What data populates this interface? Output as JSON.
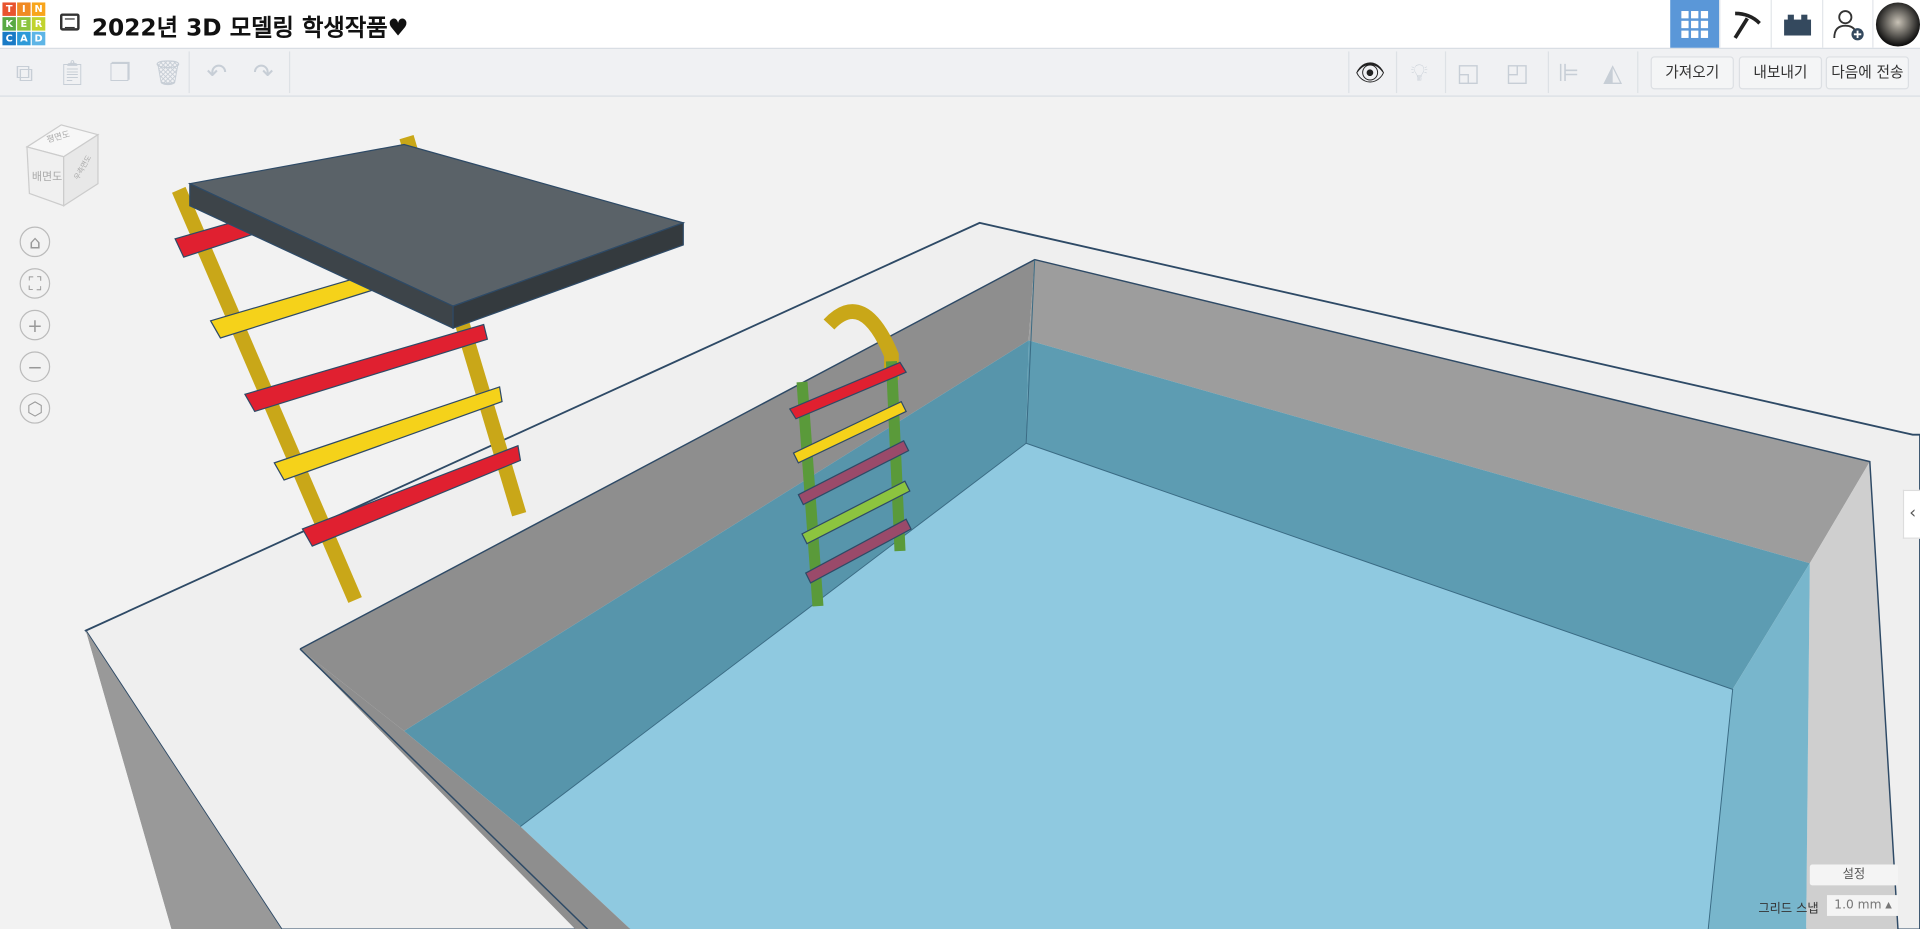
{
  "app": {
    "logo_letters": [
      "T",
      "I",
      "N",
      "K",
      "E",
      "R",
      "C",
      "A",
      "D"
    ],
    "logo_colors": [
      "#e8542f",
      "#f08a24",
      "#f8a51c",
      "#59a944",
      "#8cc43f",
      "#c1d32f",
      "#1a7bc6",
      "#2d9ad8",
      "#5eb5e6"
    ],
    "title": "2022년 3D 모델링 학생작품♥"
  },
  "header_icons": [
    {
      "name": "grid-view-icon",
      "active": true
    },
    {
      "name": "pickaxe-icon"
    },
    {
      "name": "brick-icon"
    },
    {
      "name": "add-user-icon"
    },
    {
      "name": "avatar"
    }
  ],
  "toolbar": {
    "left_tools": [
      "copy-icon",
      "paste-icon",
      "duplicate-icon",
      "delete-icon",
      "undo-icon",
      "redo-icon"
    ],
    "right_tools": [
      "notes-icon",
      "light-icon",
      "shape-group-icon",
      "shape-ungroup-icon",
      "align-icon",
      "mirror-icon"
    ],
    "import_label": "가져오기",
    "export_label": "내보내기",
    "send_label": "다음에 전송"
  },
  "viewcube": {
    "top": "평면도",
    "front": "배면도",
    "side": "우측면도"
  },
  "view_controls": [
    "home-icon",
    "fit-icon",
    "zoom-in-icon",
    "zoom-out-icon",
    "perspective-icon"
  ],
  "footer": {
    "settings_label": "설정",
    "grid_snap_label": "그리드 스냅",
    "grid_snap_value": "1.0 mm"
  },
  "colors": {
    "accent": "#5a97d8",
    "water": "#8fc9e0",
    "board": "#5a6268",
    "red": "#e02030",
    "yellow": "#f5d21a",
    "pole": "#c9a718"
  }
}
